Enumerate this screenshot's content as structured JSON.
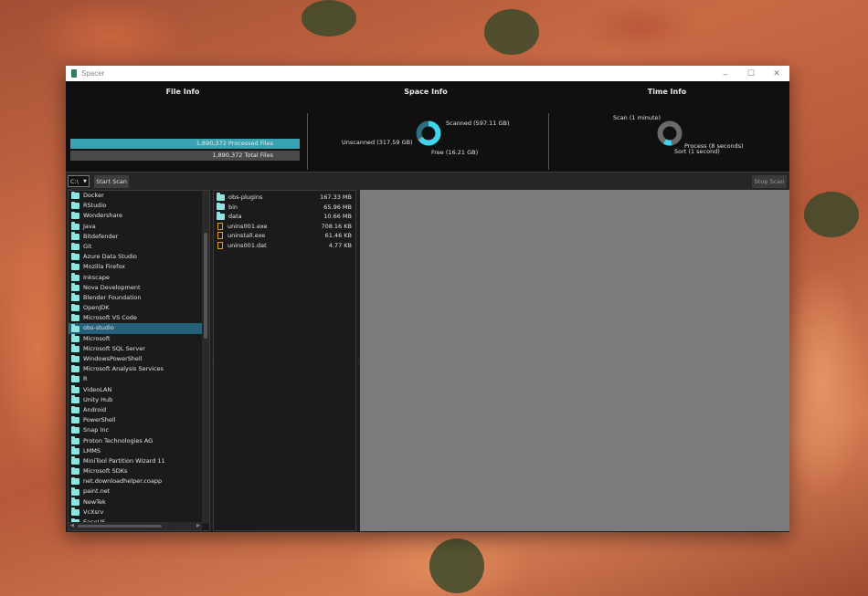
{
  "window": {
    "title": "Spacer",
    "controls": [
      "–",
      "☐",
      "✕"
    ]
  },
  "file_info": {
    "title": "File Info",
    "processed": "1,890,372 Processed Files",
    "total": "1,890,372 Total Files"
  },
  "space_info": {
    "title": "Space Info",
    "scanned": "Scanned (597.11 GB)",
    "unscanned": "Unscanned (317.59 GB)",
    "free": "Free (16.21 GB)",
    "colors": {
      "scanned": "#3fd4ec",
      "unscanned": "#2b6e7c",
      "free": "#9a9a9a"
    }
  },
  "time_info": {
    "title": "Time Info",
    "scan": "Scan (1 minute)",
    "process": "Process (8 seconds)",
    "sort": "Sort (1 second)",
    "colors": {
      "scan": "#6a6a6a",
      "process": "#3fd4ec"
    }
  },
  "toolbar": {
    "drive": "C:\\",
    "start_label": "Start Scan",
    "stop_label": "Stop Scan"
  },
  "folders": [
    "Docker",
    "RStudio",
    "Wondershare",
    "Java",
    "Bitdefender",
    "Git",
    "Azure Data Studio",
    "Mozilla Firefox",
    "Inkscape",
    "Nova Development",
    "Blender Foundation",
    "OpenJDK",
    "Microsoft VS Code",
    "obs-studio",
    "Microsoft",
    "Microsoft SQL Server",
    "WindowsPowerShell",
    "Microsoft Analysis Services",
    "R",
    "VideoLAN",
    "Unity Hub",
    "Android",
    "PowerShell",
    "Snap Inc",
    "Proton Technologies AG",
    "LMMS",
    "MiniTool Partition Wizard 11",
    "Microsoft SDKs",
    "net.downloadhelper.coapp",
    "paint.net",
    "NewTek",
    "VcXsrv",
    "EaseUS"
  ],
  "selected_folder": "obs-studio",
  "files": [
    {
      "name": "obs-plugins",
      "size": "167.33 MB",
      "type": "folder"
    },
    {
      "name": "bin",
      "size": "65.96 MB",
      "type": "folder"
    },
    {
      "name": "data",
      "size": "10.66 MB",
      "type": "folder"
    },
    {
      "name": "unins001.exe",
      "size": "708.16 KB",
      "type": "file"
    },
    {
      "name": "uninstall.exe",
      "size": "61.46 KB",
      "type": "file"
    },
    {
      "name": "unins001.dat",
      "size": "4.77 KB",
      "type": "file"
    }
  ]
}
